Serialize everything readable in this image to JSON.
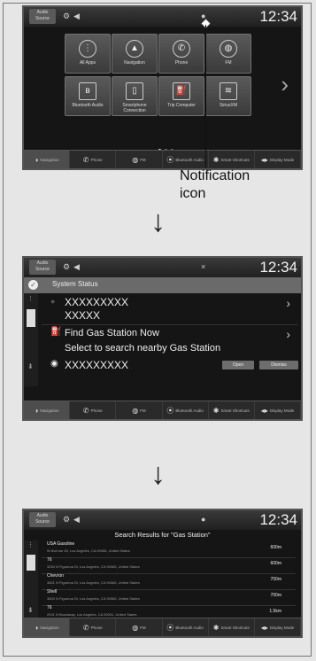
{
  "callout": {
    "label_line1": "Notification",
    "label_line2": "icon"
  },
  "flow_arrow": "↓",
  "topbar": {
    "audio_source": "Audio Source",
    "time": "12:34"
  },
  "bottombar": [
    {
      "icon": "◑",
      "label": "Navigation"
    },
    {
      "icon": "✆",
      "label": "Phone"
    },
    {
      "icon": "◍",
      "label": "FM"
    },
    {
      "icon": "⦿",
      "label": "Bluetooth Audio"
    },
    {
      "icon": "✱",
      "label": "Smart Shortcuts"
    },
    {
      "icon": "◂▸",
      "label": "Display Mode"
    }
  ],
  "home": {
    "tiles": [
      {
        "icon": "⋮",
        "label": "All Apps"
      },
      {
        "icon": "▲",
        "label": "Navigation"
      },
      {
        "icon": "✆",
        "label": "Phone"
      },
      {
        "icon": "◍",
        "label": "FM"
      },
      {
        "icon": "ʙ",
        "label": "Bluetooth Audio"
      },
      {
        "icon": "▯",
        "label": "Smartphone Connection"
      },
      {
        "icon": "⛽",
        "label": "Trip Computer"
      },
      {
        "icon": "≋",
        "label": "SiriusXM"
      }
    ],
    "next_arrow": "›"
  },
  "status": {
    "header": "System Status",
    "item1_line1": "XXXXXXXXX",
    "item1_line2": "XXXXX",
    "item2_title": "Find Gas Station Now",
    "item2_sub": "Select to search nearby Gas Station",
    "item3": "XXXXXXXXX",
    "open": "Open",
    "dismiss": "Dismiss"
  },
  "search": {
    "title": "Search Results for \"Gas Station\"",
    "results": [
      {
        "name": "USA Gasoline",
        "address": "W Avenue 26, Los Angeles, CA 90065, United States",
        "distance": "600m"
      },
      {
        "name": "76",
        "address": "3250 N Figueroa St, Los Angeles, CA 90065, United States",
        "distance": "600m"
      },
      {
        "name": "Chevron",
        "address": "3601 N Figueroa St, Los Angeles, CA 90065, United States",
        "distance": "700m"
      },
      {
        "name": "Shell",
        "address": "3600 N Figueroa St, Los Angeles, CA 90065, United States",
        "distance": "700m"
      },
      {
        "name": "76",
        "address": "2001 N Broadway, Los Angeles, CA 90031, United States",
        "distance": "1.5km"
      }
    ]
  }
}
